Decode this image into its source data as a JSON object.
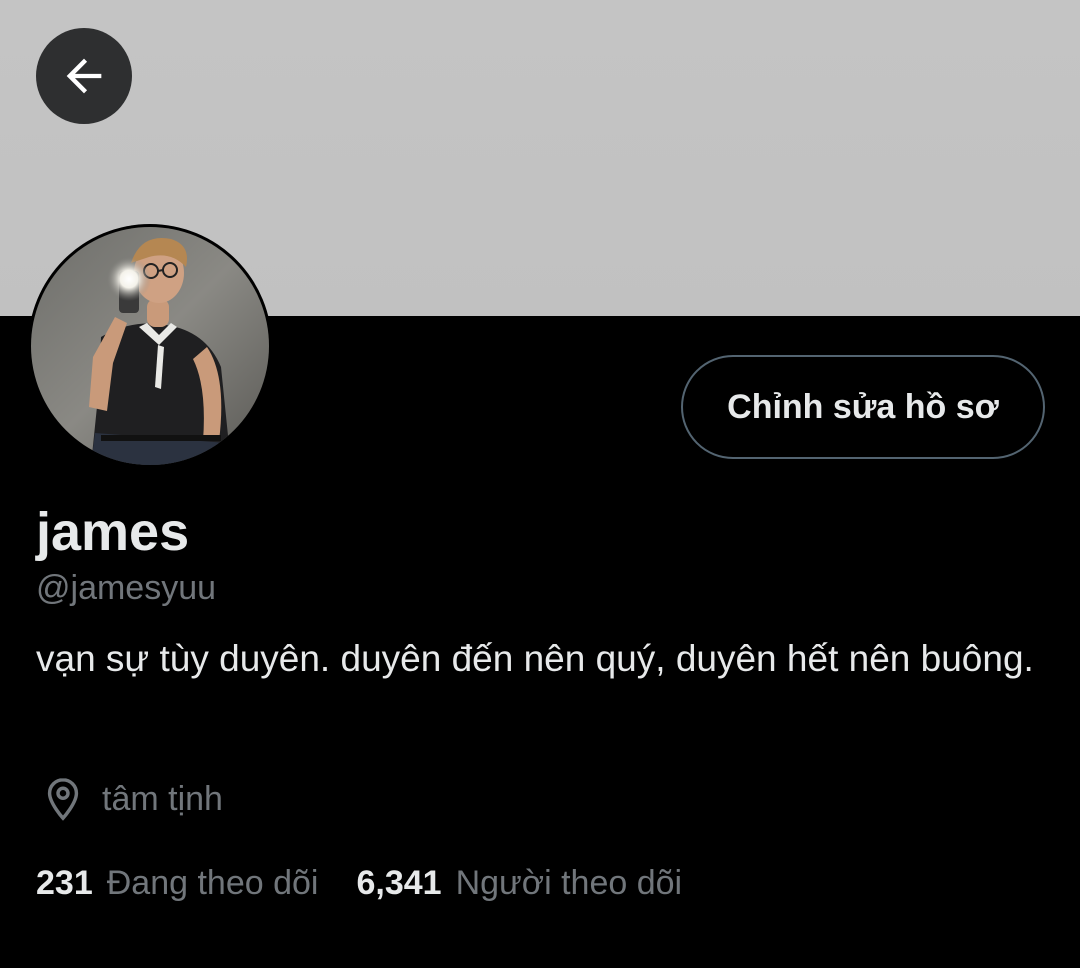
{
  "header": {
    "back_icon": "arrow-left-icon",
    "banner_color": "#c3c3c3"
  },
  "profile": {
    "avatar_icon": "avatar-photo",
    "edit_button_label": "Chỉnh sửa hồ sơ",
    "display_name": "james",
    "handle": "@jamesyuu",
    "bio": "vạn sự tùy duyên. duyên đến nên quý, duyên hết nên buông.",
    "location_icon": "location-pin-icon",
    "location": "tâm tịnh"
  },
  "stats": {
    "following_count": "231",
    "following_label": "Đang theo dõi",
    "followers_count": "6,341",
    "followers_label": "Người theo dõi"
  },
  "colors": {
    "background": "#000000",
    "primary_text": "#e7e9ea",
    "secondary_text": "#71767b",
    "border": "#536471"
  }
}
